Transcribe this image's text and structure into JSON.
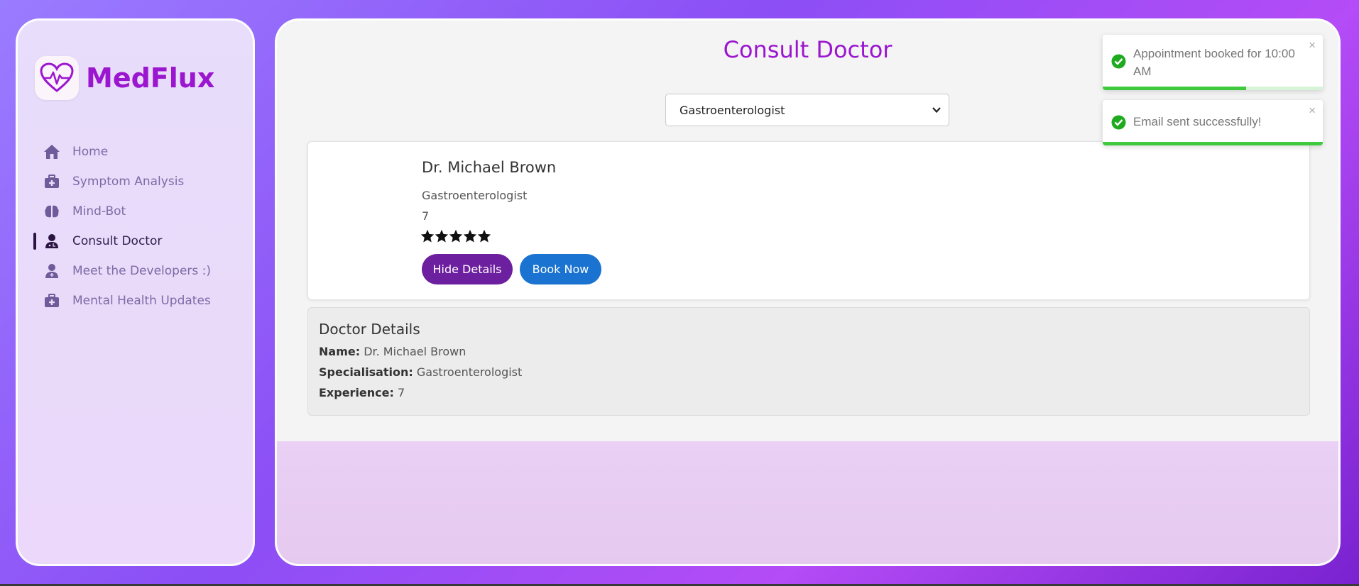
{
  "brand": {
    "name": "MedFlux",
    "logo_icon": "heart-pulse-icon"
  },
  "sidebar": {
    "items": [
      {
        "label": "Home",
        "icon": "home-icon",
        "active": false
      },
      {
        "label": "Symptom Analysis",
        "icon": "medkit-icon",
        "active": false
      },
      {
        "label": "Mind-Bot",
        "icon": "brain-icon",
        "active": false
      },
      {
        "label": "Consult Doctor",
        "icon": "doctor-icon",
        "active": true
      },
      {
        "label": "Meet the Developers :)",
        "icon": "user-doctor-icon",
        "active": false
      },
      {
        "label": "Mental Health Updates",
        "icon": "medkit-icon",
        "active": false
      }
    ]
  },
  "main": {
    "title": "Consult Doctor",
    "specialty_select": {
      "value": "Gastroenterologist"
    },
    "doctor": {
      "name": "Dr. Michael Brown",
      "specialisation": "Gastroenterologist",
      "experience": "7",
      "rating": 5,
      "rating_max": 5,
      "hide_button": "Hide Details",
      "book_button": "Book Now"
    },
    "details": {
      "title": "Doctor Details",
      "name_label": "Name:",
      "name_value": "Dr. Michael Brown",
      "spec_label": "Specialisation:",
      "spec_value": "Gastroenterologist",
      "exp_label": "Experience:",
      "exp_value": "7"
    }
  },
  "toasts": [
    {
      "text": "Appointment booked for 10:00 AM",
      "close": "×",
      "progress": 0.65
    },
    {
      "text": "Email sent successfully!",
      "close": "×",
      "progress": 1.0
    }
  ],
  "colors": {
    "brand": "#9b16cf",
    "hide_button": "#6c1f9e",
    "book_button": "#1a73d0",
    "toast_success": "#3fc93f",
    "nav_text": "#7d6aa5"
  }
}
